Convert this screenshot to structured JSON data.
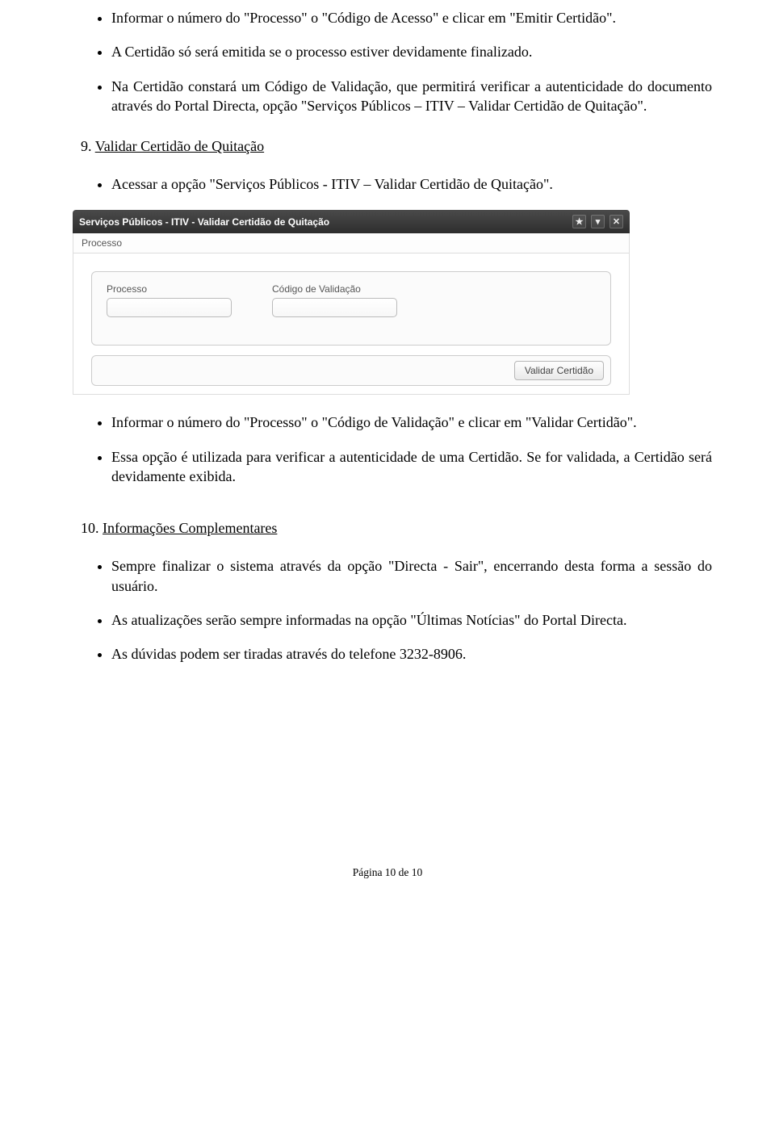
{
  "top_bullets": [
    "Informar o número do \"Processo\" o \"Código de Acesso\" e clicar em \"Emitir Certidão\".",
    "A Certidão só será emitida se o processo estiver devidamente finalizado.",
    "Na Certidão constará um Código de Validação, que permitirá verificar a autenticidade do documento através do Portal Directa, opção \"Serviços Públicos – ITIV – Validar Certidão de Quitação\"."
  ],
  "section9": {
    "num": "9.",
    "title": "Validar Certidão de Quitação",
    "bullet_pre": "Acessar a opção \"Serviços Públicos - ITIV – Validar Certidão de Quitação\".",
    "bullet_post_1": "Informar o número do \"Processo\" o \"Código de Validação\" e clicar em \"Validar Certidão\".",
    "bullet_post_2": "Essa opção é utilizada para verificar a autenticidade de uma Certidão. Se for validada, a Certidão será devidamente exibida."
  },
  "app_window": {
    "title": "Serviços Públicos - ITIV - Validar Certidão de Quitação",
    "toolbar_menu": "Processo",
    "field1_label": "Processo",
    "field2_label": "Código de Validação",
    "button_label": "Validar Certidão",
    "icons": {
      "star": "★",
      "down": "▾",
      "close": "✕"
    }
  },
  "section10": {
    "num": "10.",
    "title": "Informações Complementares",
    "bullets": [
      "Sempre finalizar o sistema através da opção \"Directa - Sair\", encerrando desta forma a sessão do usuário.",
      "As atualizações serão sempre informadas na opção \"Últimas Notícias\" do Portal Directa.",
      "As dúvidas podem ser tiradas através do telefone 3232-8906."
    ]
  },
  "footer": "Página 10 de 10"
}
